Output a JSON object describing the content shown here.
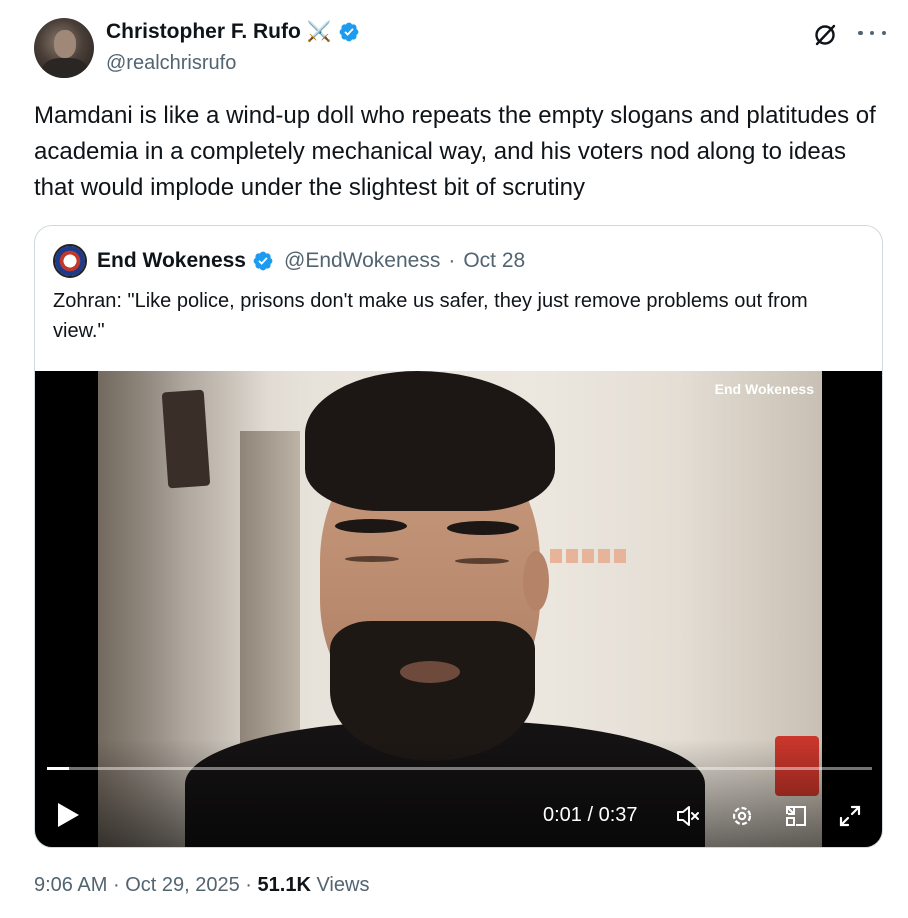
{
  "author": {
    "name": "Christopher F. Rufo",
    "emoji": "⚔️",
    "handle": "@realchrisrufo"
  },
  "tweet": {
    "text": "Mamdani is like a wind-up doll who repeats the empty slogans and platitudes of academia in a completely mechanical way, and his voters nod along to ideas that would implode under the slightest bit of scrutiny"
  },
  "quote": {
    "name": "End Wokeness",
    "handle": "@EndWokeness",
    "separator": "·",
    "date": "Oct 28",
    "text": "Zohran: \"Like police, prisons don't make us safer, they just remove problems out from view.\"",
    "video": {
      "watermark": "End Wokeness",
      "time": "0:01 / 0:37",
      "progress": 0.027
    }
  },
  "footer": {
    "time": "9:06 AM",
    "sep1": "·",
    "date": "Oct 29, 2025",
    "sep2": "·",
    "views_count": "51.1K",
    "views_label": "Views"
  },
  "colors": {
    "verified": "#1d9bf0",
    "text_primary": "#0f1419",
    "text_secondary": "#536471",
    "border": "#cfd9de"
  },
  "icons": [
    "verified-badge-icon",
    "grok-icon",
    "more-icon",
    "play-icon",
    "mute-icon",
    "settings-icon",
    "pip-icon",
    "fullscreen-icon"
  ]
}
